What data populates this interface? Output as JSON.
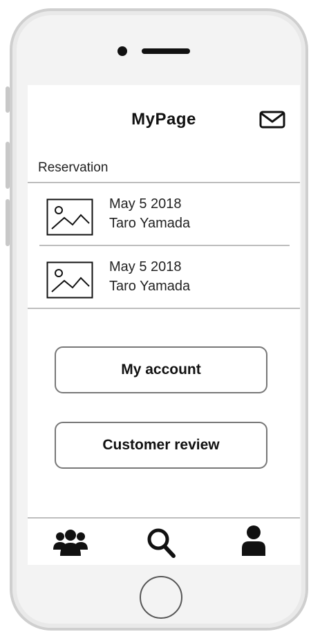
{
  "header": {
    "title": "MyPage",
    "mail_icon": "envelope-icon"
  },
  "reservations": {
    "label": "Reservation",
    "items": [
      {
        "date": "May 5 2018",
        "name": "Taro Yamada",
        "thumbnail": "image-placeholder-icon"
      },
      {
        "date": "May 5 2018",
        "name": "Taro Yamada",
        "thumbnail": "image-placeholder-icon"
      }
    ]
  },
  "actions": {
    "my_account_label": "My account",
    "customer_review_label": "Customer review"
  },
  "tabbar": {
    "items": [
      {
        "icon": "users-group-icon"
      },
      {
        "icon": "search-icon"
      },
      {
        "icon": "user-profile-icon"
      }
    ]
  }
}
